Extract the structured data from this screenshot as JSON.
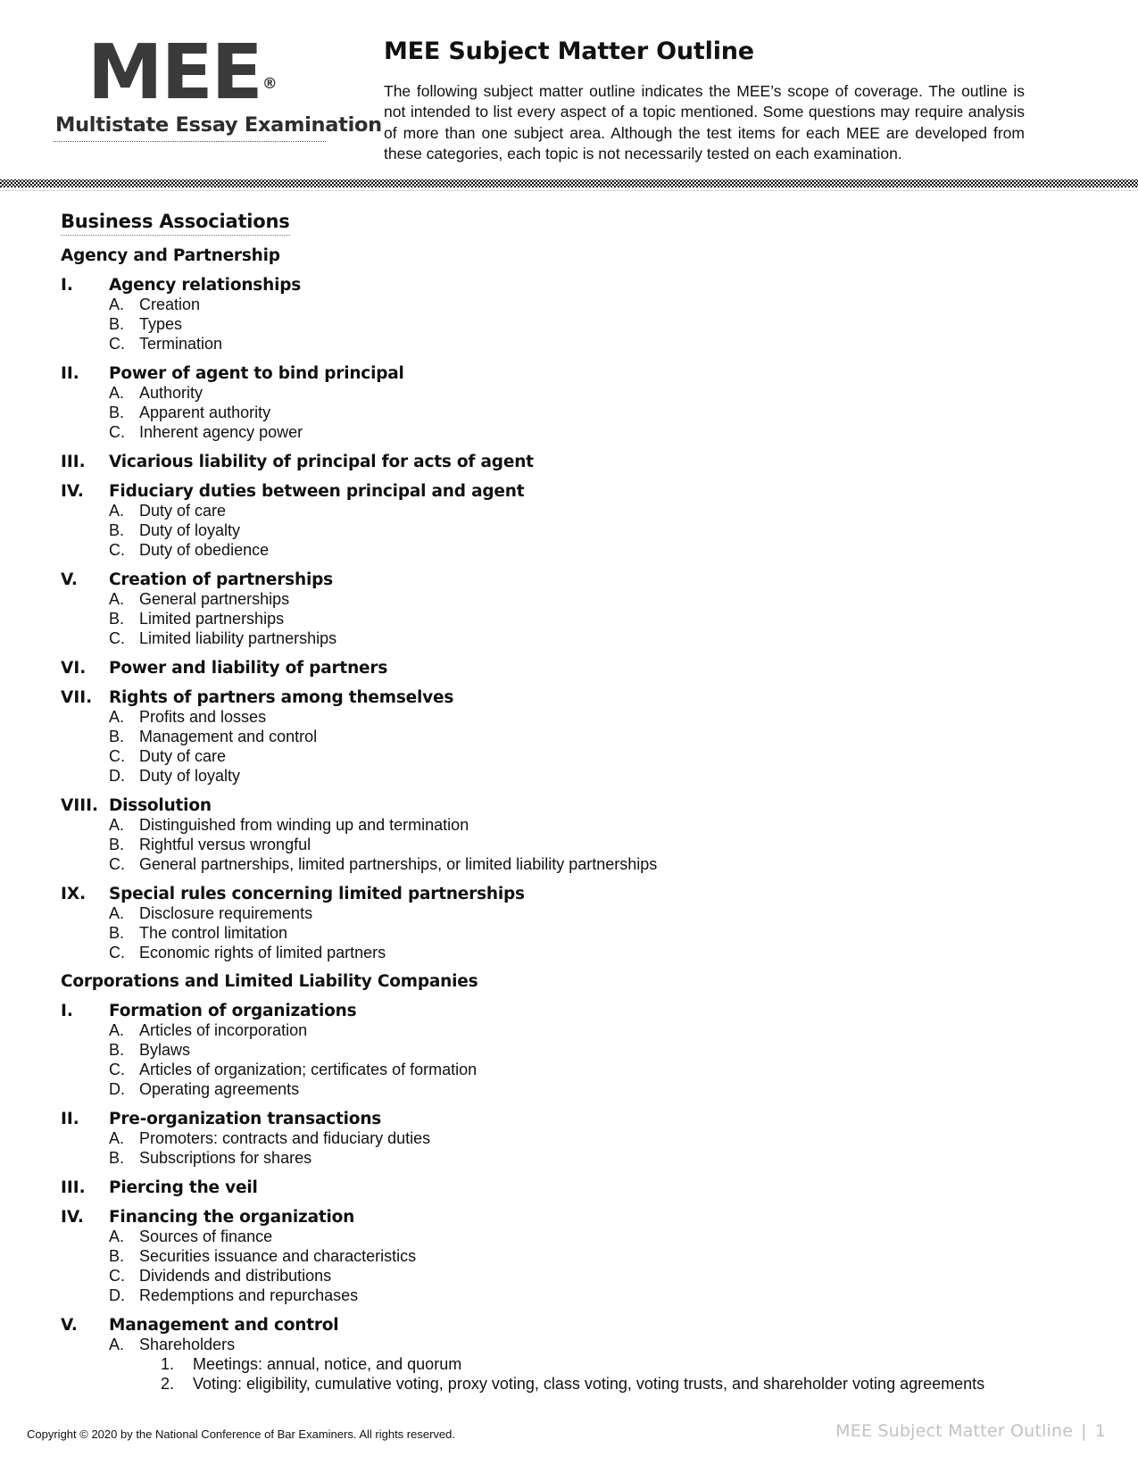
{
  "header": {
    "logo_main": "MEE",
    "logo_registered": "®",
    "logo_subtitle": "Multistate Essay Examination",
    "title": "MEE Subject Matter Outline",
    "intro": "The following subject matter outline indicates the MEE’s scope of coverage. The outline is not intended to list every aspect of a topic mentioned. Some questions may require analysis of more than one subject area. Although the test items for each MEE are developed from these categories, each topic is not necessarily tested on each examination."
  },
  "subject": {
    "title": "Business Associations",
    "sections": [
      {
        "heading": "Agency and Partnership",
        "items": [
          {
            "num": "I.",
            "text": "Agency relationships",
            "sub": [
              {
                "num": "A.",
                "text": "Creation"
              },
              {
                "num": "B.",
                "text": "Types"
              },
              {
                "num": "C.",
                "text": "Termination"
              }
            ]
          },
          {
            "num": "II.",
            "text": "Power of agent to bind principal",
            "sub": [
              {
                "num": "A.",
                "text": "Authority"
              },
              {
                "num": "B.",
                "text": "Apparent authority"
              },
              {
                "num": "C.",
                "text": "Inherent agency power"
              }
            ]
          },
          {
            "num": "III.",
            "text": "Vicarious liability of principal for acts of agent",
            "sub": []
          },
          {
            "num": "IV.",
            "text": "Fiduciary duties between principal and agent",
            "sub": [
              {
                "num": "A.",
                "text": "Duty of care"
              },
              {
                "num": "B.",
                "text": "Duty of loyalty"
              },
              {
                "num": "C.",
                "text": "Duty of obedience"
              }
            ]
          },
          {
            "num": "V.",
            "text": "Creation of partnerships",
            "sub": [
              {
                "num": "A.",
                "text": "General partnerships"
              },
              {
                "num": "B.",
                "text": "Limited partnerships"
              },
              {
                "num": "C.",
                "text": "Limited liability partnerships"
              }
            ]
          },
          {
            "num": "VI.",
            "text": "Power and liability of partners",
            "sub": []
          },
          {
            "num": "VII.",
            "text": "Rights of partners among themselves",
            "sub": [
              {
                "num": "A.",
                "text": "Profits and losses"
              },
              {
                "num": "B.",
                "text": "Management and control"
              },
              {
                "num": "C.",
                "text": "Duty of care"
              },
              {
                "num": "D.",
                "text": "Duty of loyalty"
              }
            ]
          },
          {
            "num": "VIII.",
            "text": "Dissolution",
            "sub": [
              {
                "num": "A.",
                "text": "Distinguished from winding up and termination"
              },
              {
                "num": "B.",
                "text": "Rightful versus wrongful"
              },
              {
                "num": "C.",
                "text": "General partnerships, limited partnerships, or limited liability partnerships"
              }
            ]
          },
          {
            "num": "IX.",
            "text": "Special rules concerning limited partnerships",
            "sub": [
              {
                "num": "A.",
                "text": "Disclosure requirements"
              },
              {
                "num": "B.",
                "text": "The control limitation"
              },
              {
                "num": "C.",
                "text": "Economic rights of limited partners"
              }
            ]
          }
        ]
      },
      {
        "heading": "Corporations and Limited Liability Companies",
        "items": [
          {
            "num": "I.",
            "text": "Formation of organizations",
            "sub": [
              {
                "num": "A.",
                "text": "Articles of incorporation"
              },
              {
                "num": "B.",
                "text": "Bylaws"
              },
              {
                "num": "C.",
                "text": "Articles of organization; certificates of formation"
              },
              {
                "num": "D.",
                "text": "Operating agreements"
              }
            ]
          },
          {
            "num": "II.",
            "text": "Pre-organization transactions",
            "sub": [
              {
                "num": "A.",
                "text": "Promoters: contracts and fiduciary duties"
              },
              {
                "num": "B.",
                "text": "Subscriptions for shares"
              }
            ]
          },
          {
            "num": "III.",
            "text": "Piercing the veil",
            "sub": []
          },
          {
            "num": "IV.",
            "text": "Financing the organization",
            "sub": [
              {
                "num": "A.",
                "text": "Sources of finance"
              },
              {
                "num": "B.",
                "text": "Securities issuance and characteristics"
              },
              {
                "num": "C.",
                "text": "Dividends and distributions"
              },
              {
                "num": "D.",
                "text": "Redemptions and repurchases"
              }
            ]
          },
          {
            "num": "V.",
            "text": "Management and control",
            "sub": [
              {
                "num": "A.",
                "text": "Shareholders",
                "sub": [
                  {
                    "num": "1.",
                    "text": "Meetings: annual, notice, and quorum"
                  },
                  {
                    "num": "2.",
                    "text": "Voting: eligibility, cumulative voting, proxy voting, class voting, voting trusts, and shareholder voting agreements"
                  }
                ]
              }
            ]
          }
        ]
      }
    ]
  },
  "footer": {
    "copyright": "Copyright © 2020 by the National Conference of Bar Examiners. All rights reserved.",
    "running_title": "MEE Subject Matter Outline",
    "separator": "|",
    "page_number": "1"
  }
}
